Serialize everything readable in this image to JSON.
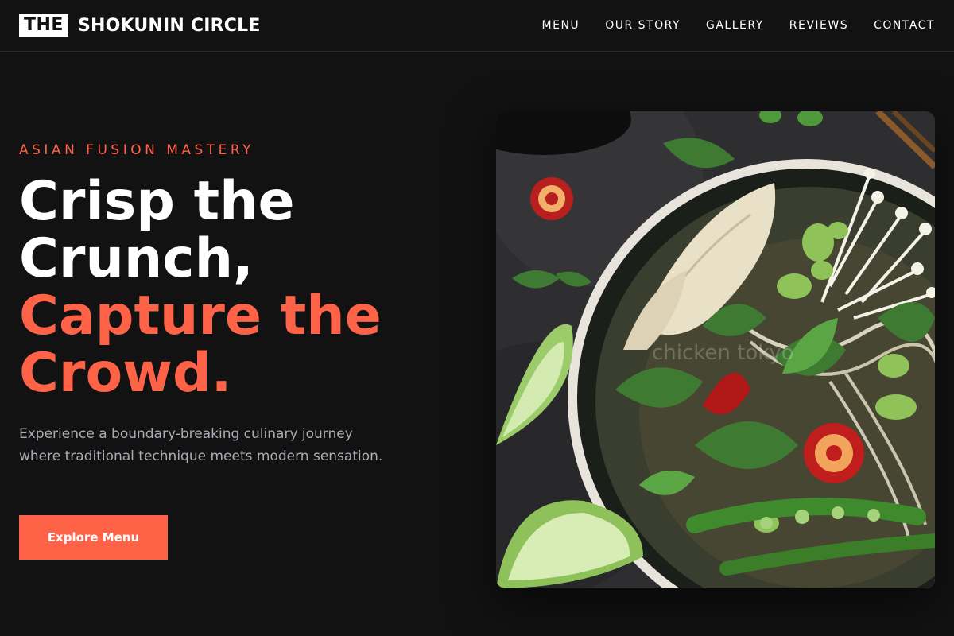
{
  "brand": {
    "logo_box": "THE",
    "logo_text": "SHOKUNIN CIRCLE"
  },
  "nav": {
    "items": [
      {
        "label": "MENU"
      },
      {
        "label": "OUR STORY"
      },
      {
        "label": "GALLERY"
      },
      {
        "label": "REVIEWS"
      },
      {
        "label": "CONTACT"
      }
    ]
  },
  "hero": {
    "eyebrow": "ASIAN FUSION MASTERY",
    "headline_line1": "Crisp the",
    "headline_line2": "Crunch,",
    "headline_line3": "Capture the",
    "headline_line4": "Crowd.",
    "subtext": "Experience a boundary-breaking culinary journey where traditional technique meets modern sensation.",
    "cta_label": "Explore Menu",
    "image_alt": "Bowl of noodle soup with herbs, chili, enoki mushrooms and edamame",
    "watermark": "chicken tokyo"
  },
  "colors": {
    "background": "#121213",
    "accent": "#ff6347",
    "text": "#ffffff",
    "muted": "#a9adb5"
  }
}
